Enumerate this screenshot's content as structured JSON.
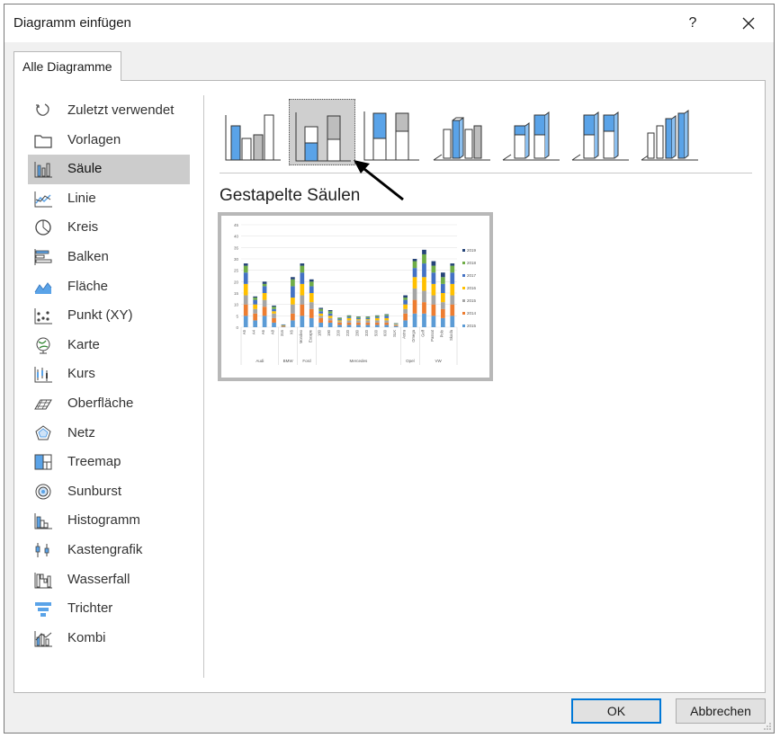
{
  "window": {
    "title": "Diagramm einfügen",
    "help_label": "?"
  },
  "tabs": [
    {
      "label": "Alle Diagramme"
    }
  ],
  "sidebar": {
    "items": [
      {
        "label": "Zuletzt verwendet",
        "icon": "recent-icon"
      },
      {
        "label": "Vorlagen",
        "icon": "folder-icon"
      },
      {
        "label": "Säule",
        "icon": "column-chart-icon",
        "selected": true
      },
      {
        "label": "Linie",
        "icon": "line-chart-icon"
      },
      {
        "label": "Kreis",
        "icon": "pie-chart-icon"
      },
      {
        "label": "Balken",
        "icon": "bar-chart-icon"
      },
      {
        "label": "Fläche",
        "icon": "area-chart-icon"
      },
      {
        "label": "Punkt (XY)",
        "icon": "scatter-chart-icon"
      },
      {
        "label": "Karte",
        "icon": "map-chart-icon"
      },
      {
        "label": "Kurs",
        "icon": "stock-chart-icon"
      },
      {
        "label": "Oberfläche",
        "icon": "surface-chart-icon"
      },
      {
        "label": "Netz",
        "icon": "radar-chart-icon"
      },
      {
        "label": "Treemap",
        "icon": "treemap-icon"
      },
      {
        "label": "Sunburst",
        "icon": "sunburst-icon"
      },
      {
        "label": "Histogramm",
        "icon": "histogram-icon"
      },
      {
        "label": "Kastengrafik",
        "icon": "box-whisker-icon"
      },
      {
        "label": "Wasserfall",
        "icon": "waterfall-icon"
      },
      {
        "label": "Trichter",
        "icon": "funnel-icon"
      },
      {
        "label": "Kombi",
        "icon": "combo-chart-icon"
      }
    ]
  },
  "subtypes": {
    "selected_index": 1,
    "items": [
      {
        "icon": "clustered-column-icon"
      },
      {
        "icon": "stacked-column-icon"
      },
      {
        "icon": "stacked-100-column-icon"
      },
      {
        "icon": "3d-clustered-column-icon"
      },
      {
        "icon": "3d-stacked-column-icon"
      },
      {
        "icon": "3d-stacked-100-column-icon"
      },
      {
        "icon": "3d-column-icon"
      }
    ],
    "selected_title": "Gestapelte Säulen"
  },
  "colors": {
    "accent_blue": "#5aa3e8",
    "selected_bg": "#cccccc",
    "default_button_border": "#0078d7"
  },
  "chart_data": {
    "type": "bar",
    "stacked": true,
    "yticks": [
      "45",
      "40",
      "35",
      "30",
      "25",
      "20",
      "15",
      "10",
      "5",
      "0"
    ],
    "ylim": [
      0,
      45
    ],
    "categories": [
      "A5",
      "A4",
      "A6",
      "A8",
      "316",
      "X6",
      "Mondeo",
      "Escape",
      "180",
      "190",
      "200",
      "220",
      "280",
      "320",
      "500",
      "600",
      "SLK",
      "Astra",
      "Omega",
      "Golf",
      "Passat",
      "Polo",
      "Skoda"
    ],
    "groups": [
      {
        "name": "Audi",
        "count": 4
      },
      {
        "name": "BMW",
        "count": 2
      },
      {
        "name": "Ford",
        "count": 2
      },
      {
        "name": "Mercedes",
        "count": 9
      },
      {
        "name": "Opel",
        "count": 2
      },
      {
        "name": "VW",
        "count": 4
      }
    ],
    "legend_position": "right",
    "series": [
      {
        "name": "2015",
        "color": "#5b9bd5",
        "values": [
          5,
          3,
          5,
          2,
          0.2,
          3,
          5,
          4,
          2,
          2,
          1,
          1,
          1,
          1,
          1,
          1,
          0.5,
          3,
          6,
          6,
          5,
          4,
          5
        ]
      },
      {
        "name": "2014",
        "color": "#ed7d31",
        "values": [
          5,
          3,
          4,
          2,
          0.2,
          3,
          5,
          4,
          2,
          1,
          1,
          1,
          1,
          1,
          1,
          1,
          0.3,
          3,
          6,
          5,
          5,
          4,
          5
        ]
      },
      {
        "name": "2016",
        "color": "#a5a5a5",
        "values": [
          4,
          2,
          3,
          2,
          0.2,
          4,
          4,
          3,
          1,
          1,
          0.5,
          1,
          1,
          1,
          1,
          1,
          0.3,
          2,
          5,
          5,
          4,
          3,
          4
        ]
      },
      {
        "name": "2016",
        "color": "#ffc000",
        "values": [
          5,
          2,
          3,
          1,
          0.2,
          3,
          5,
          4,
          1,
          1,
          0.5,
          1,
          0.5,
          0.5,
          1,
          1,
          0.2,
          2,
          5,
          6,
          5,
          4,
          5
        ]
      },
      {
        "name": "2017",
        "color": "#4472c4",
        "values": [
          5,
          2,
          3,
          1,
          0.2,
          5,
          5,
          3,
          1,
          1,
          0.5,
          0.5,
          0.5,
          0.5,
          0.5,
          1,
          0.2,
          2,
          4,
          6,
          5,
          4,
          5
        ]
      },
      {
        "name": "2018",
        "color": "#70ad47",
        "values": [
          3,
          1,
          1,
          1,
          0.1,
          3,
          3,
          2,
          1,
          1,
          0.5,
          0.5,
          0.5,
          0.5,
          0.5,
          0.5,
          0.2,
          1,
          3,
          4,
          3,
          3,
          3
        ]
      },
      {
        "name": "2019",
        "color": "#264478",
        "values": [
          1,
          0.5,
          1,
          0.5,
          0.1,
          1,
          1,
          1,
          0.5,
          0.5,
          0.2,
          0.2,
          0.2,
          0.2,
          0.2,
          0.2,
          0.1,
          1,
          1,
          2,
          2,
          2,
          1
        ]
      }
    ],
    "legend": [
      "2019",
      "2018",
      "2017",
      "2016",
      "2015",
      "2014",
      "2015"
    ]
  },
  "buttons": {
    "ok": "OK",
    "cancel": "Abbrechen"
  }
}
